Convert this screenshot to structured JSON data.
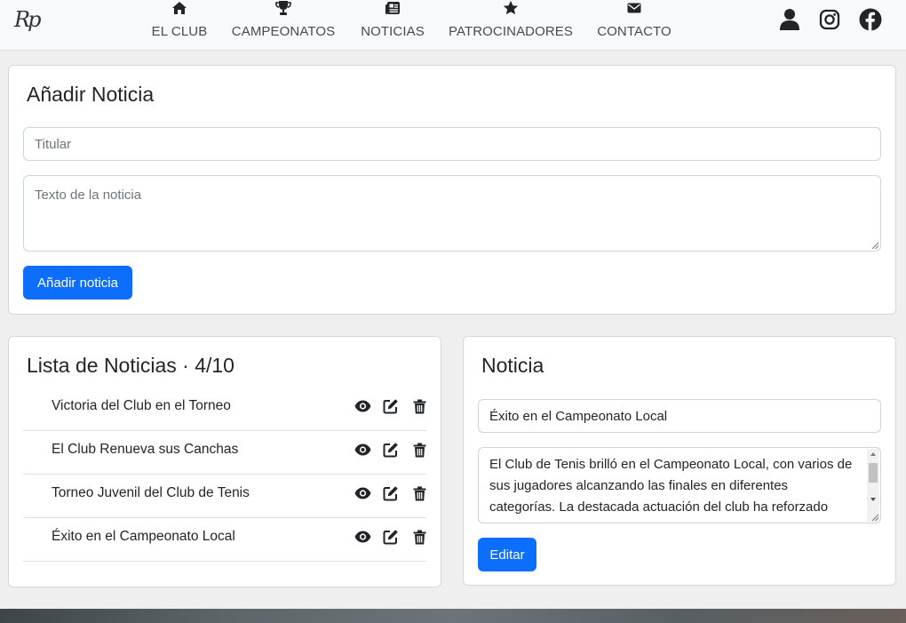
{
  "header": {
    "logo_text": "Rp",
    "nav": [
      {
        "label": "EL CLUB",
        "icon": "home-icon"
      },
      {
        "label": "CAMPEONATOS",
        "icon": "trophy-icon"
      },
      {
        "label": "NOTICIAS",
        "icon": "newspaper-icon"
      },
      {
        "label": "PATROCINADORES",
        "icon": "star-icon"
      },
      {
        "label": "CONTACTO",
        "icon": "envelope-icon"
      }
    ],
    "social": [
      "user-icon",
      "instagram-icon",
      "facebook-icon"
    ]
  },
  "add_news": {
    "title": "Añadir Noticia",
    "headline_placeholder": "Titular",
    "body_placeholder": "Texto de la noticia",
    "submit_label": "Añadir noticia"
  },
  "news_list": {
    "title": "Lista de Noticias · 4/10",
    "items": [
      {
        "title": "Victoria del Club en el Torneo"
      },
      {
        "title": "El Club Renueva sus Canchas"
      },
      {
        "title": "Torneo Juvenil del Club de Tenis"
      },
      {
        "title": "Éxito en el Campeonato Local"
      }
    ]
  },
  "news_detail": {
    "title": "Noticia",
    "headline_value": "Éxito en el Campeonato Local",
    "body_value": "El Club de Tenis brilló en el Campeonato Local, con varios de sus jugadores alcanzando las finales en diferentes categorías. La destacada actuación del club ha reforzado",
    "edit_label": "Editar"
  },
  "colors": {
    "primary": "#0d6efd",
    "page_bg": "#efefef",
    "navbar_bg": "#f8f9fa",
    "icon": "#212529"
  }
}
